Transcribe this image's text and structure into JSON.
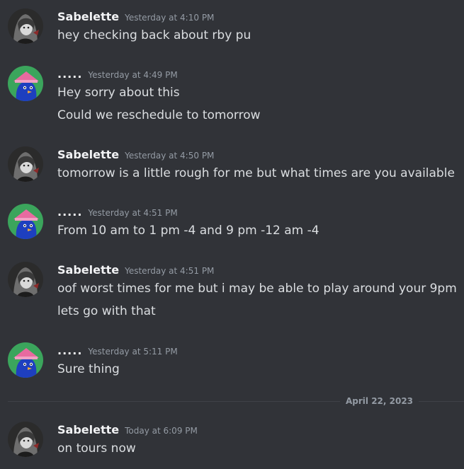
{
  "users": {
    "sabelette": {
      "name": "Sabelette",
      "avatar_icon": "anime-girl-avatar-icon"
    },
    "dots": {
      "name": ".....",
      "avatar_icon": "blue-bird-pink-hat-avatar-icon",
      "avatar_bg": "#3ba55c"
    }
  },
  "messages": [
    {
      "author": "Sabelette",
      "timestamp": "Yesterday at 4:10 PM",
      "lines": [
        "hey checking back about rby pu"
      ]
    },
    {
      "author": ".....",
      "timestamp": "Yesterday at 4:49 PM",
      "lines": [
        "Hey sorry about this",
        "Could we reschedule to tomorrow"
      ]
    },
    {
      "author": "Sabelette",
      "timestamp": "Yesterday at 4:50 PM",
      "lines": [
        "tomorrow is a little rough for me but what times are you available"
      ]
    },
    {
      "author": ".....",
      "timestamp": "Yesterday at 4:51 PM",
      "lines": [
        "From 10 am to 1 pm -4 and 9 pm -12 am -4"
      ]
    },
    {
      "author": "Sabelette",
      "timestamp": "Yesterday at 4:51 PM",
      "lines": [
        "oof worst times for me but i may be able to play around your 9pm",
        "lets go with that"
      ]
    },
    {
      "author": ".....",
      "timestamp": "Yesterday at 5:11 PM",
      "lines": [
        "Sure thing"
      ]
    },
    {
      "author": "Sabelette",
      "timestamp": "Today at 6:09 PM",
      "lines": [
        "on tours now"
      ]
    }
  ],
  "date_divider": {
    "label": "April 22, 2023"
  },
  "colors": {
    "background": "#313338",
    "username": "#f2f3f5",
    "timestamp": "#949ba4",
    "message_text": "#dbdee1",
    "divider": "#3f4147"
  }
}
